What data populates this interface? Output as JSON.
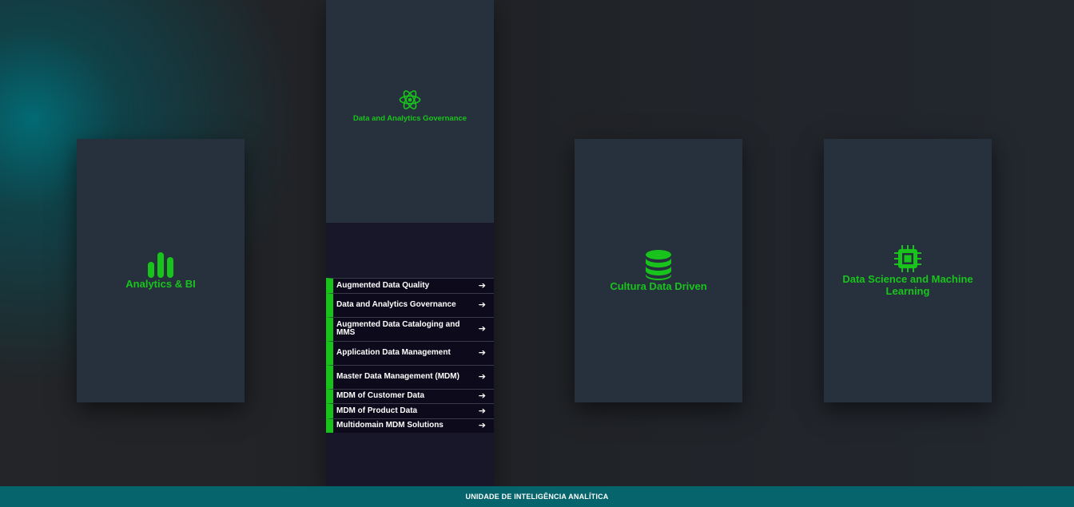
{
  "cards": {
    "analytics": {
      "title": "Analytics & BI",
      "icon": "bar-chart-icon"
    },
    "governance": {
      "title": "Data and Analytics Governance",
      "icon": "atom-icon",
      "items": [
        {
          "label": "Augmented Data Quality"
        },
        {
          "label": "Data and Analytics Governance"
        },
        {
          "label": "Augmented Data Cataloging and MMS"
        },
        {
          "label": "Application Data Management"
        },
        {
          "label": "Master Data Management (MDM)"
        },
        {
          "label": "MDM of Customer Data"
        },
        {
          "label": "MDM of Product Data"
        },
        {
          "label": "Multidomain MDM Solutions"
        }
      ]
    },
    "cultura": {
      "title": "Cultura Data Driven",
      "icon": "database-icon"
    },
    "datascience": {
      "title": "Data Science and Machine Learning",
      "icon": "chip-icon"
    }
  },
  "footer": {
    "text": "UNIDADE DE INTELIGÊNCIA ANALÍTICA"
  },
  "colors": {
    "accent_green": "#18c41c",
    "card_bg": "#27313d",
    "list_bg": "#0d0b1b",
    "footer_bg": "#06656c"
  }
}
